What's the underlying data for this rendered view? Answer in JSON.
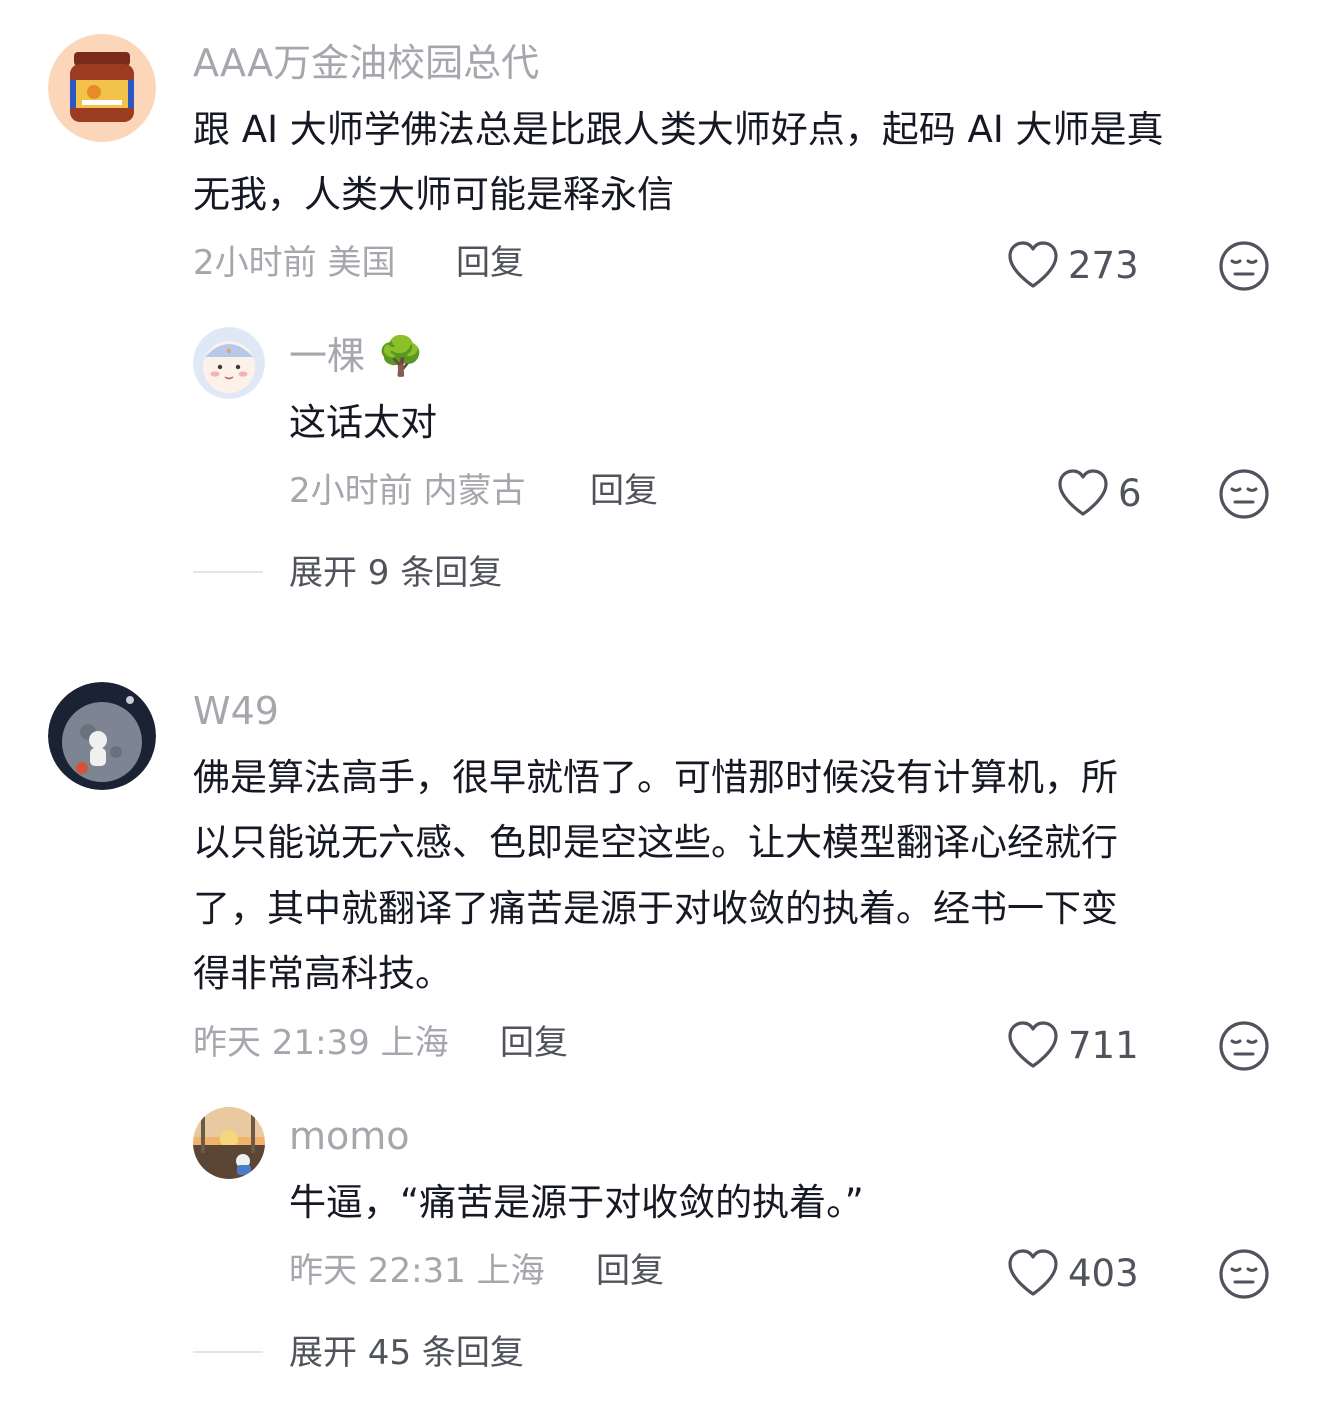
{
  "comments": [
    {
      "user": "AAA万金油校园总代",
      "avatar_icon": "tiger-balm-jar-avatar",
      "text_lines": [
        "跟 AI 大师学佛法总是比跟人类大师好点，起码 AI 大师是真",
        "无我，人类大师可能是释永信"
      ],
      "meta": "2小时前 美国",
      "reply_label": "回复",
      "likes": "273",
      "replies": [
        {
          "user": "一棵",
          "user_emoji": "🌳",
          "avatar_icon": "cartoon-buddha-avatar",
          "text": "这话太对",
          "meta": "2小时前 内蒙古",
          "reply_label": "回复",
          "likes": "6"
        }
      ],
      "expand_label": "展开 9 条回复"
    },
    {
      "user": "W49",
      "avatar_icon": "astronaut-moon-avatar",
      "text_lines": [
        "佛是算法高手，很早就悟了。可惜那时候没有计算机，所",
        "以只能说无六感、色即是空这些。让大模型翻译心经就行",
        "了，其中就翻译了痛苦是源于对收敛的执着。经书一下变",
        "得非常高科技。"
      ],
      "meta": "昨天 21:39 上海",
      "reply_label": "回复",
      "likes": "711",
      "replies": [
        {
          "user": "momo",
          "user_emoji": "",
          "avatar_icon": "sunset-room-avatar",
          "text": "牛逼，“痛苦是源于对收敛的执着。”",
          "meta": "昨天 22:31 上海",
          "reply_label": "回复",
          "likes": "403"
        }
      ],
      "expand_label": "展开 45 条回复"
    }
  ],
  "colors": {
    "primary_text": "#161823",
    "secondary_text": "#a5a7ad",
    "action_text": "#50535b",
    "icon": "#50535b"
  }
}
